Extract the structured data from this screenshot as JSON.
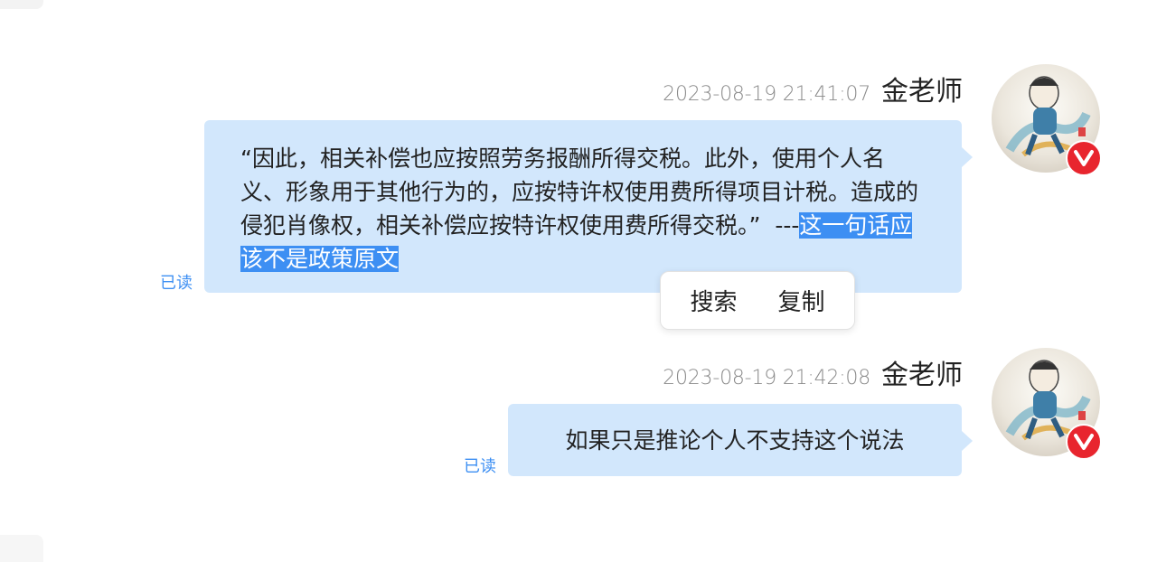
{
  "messages": [
    {
      "timestamp": "2023-08-19 21:41:07",
      "sender": "金老师",
      "text_main": "“因此，相关补偿也应按照劳务报酬所得交税。此外，使用个人名义、形象用于其他行为的，应按特许权使用费所得项目计税。造成的侵犯肖像权，相关补偿应按特许权使用费所得交税。”  ---",
      "text_selected": "这一句话应该不是政策原文",
      "read_status": "已读"
    },
    {
      "timestamp": "2023-08-19 21:42:08",
      "sender": "金老师",
      "text": "如果只是推论个人不支持这个说法",
      "read_status": "已读"
    }
  ],
  "context_menu": {
    "items": [
      "搜索",
      "复制"
    ]
  },
  "colors": {
    "bubble": "#d2e7fc",
    "selection": "#3d8ff3",
    "read_status": "#3d8ff3",
    "badge": "#e8252e"
  },
  "icons": {
    "avatar_badge": "v-badge-icon"
  }
}
